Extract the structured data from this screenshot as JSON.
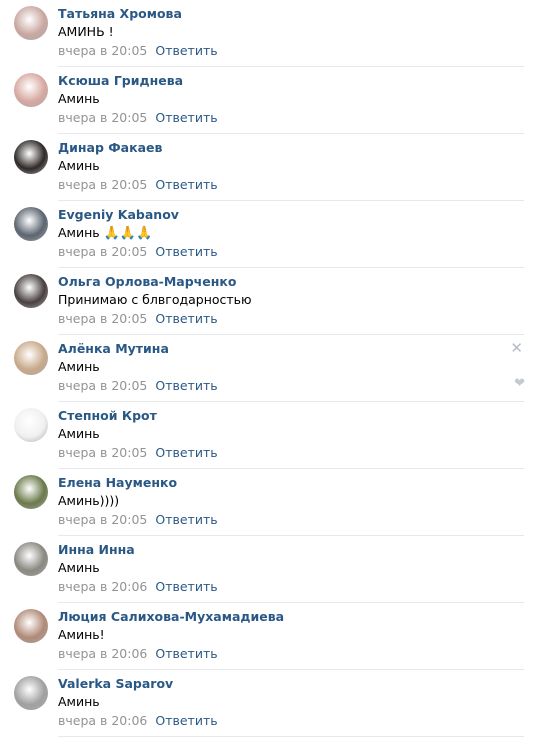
{
  "comments": [
    {
      "author": "Татьяна Хромова",
      "text": "АМИНЬ !",
      "date": "вчера в 20:05",
      "reply_label": "Ответить",
      "avatar_icon": "user-photo-icon",
      "avatar_color": "#c9a7a0"
    },
    {
      "author": "Ксюша Гриднева",
      "text": "Аминь",
      "date": "вчера в 20:05",
      "reply_label": "Ответить",
      "avatar_icon": "user-photo-icon",
      "avatar_color": "#d7a8a1"
    },
    {
      "author": "Динар Факаев",
      "text": "Аминь",
      "date": "вчера в 20:05",
      "reply_label": "Ответить",
      "avatar_icon": "user-photo-icon",
      "avatar_color": "#2f2a28"
    },
    {
      "author": "Evgeniy Kabanov",
      "text": "Аминь",
      "emoji": "🙏🙏🙏",
      "date": "вчера в 20:05",
      "reply_label": "Ответить",
      "avatar_icon": "user-photo-icon",
      "avatar_color": "#5b6570"
    },
    {
      "author": "Ольга Орлова-Марченко",
      "text": "Принимаю с блвгодарностью",
      "date": "вчера в 20:05",
      "reply_label": "Ответить",
      "avatar_icon": "user-photo-icon",
      "avatar_color": "#4a4040"
    },
    {
      "author": "Алёнка Мутина",
      "text": "Аминь",
      "date": "вчера в 20:05",
      "reply_label": "Ответить",
      "avatar_icon": "user-photo-icon",
      "avatar_color": "#c8a98a",
      "hover": true
    },
    {
      "author": "Степной Крот",
      "text": "Аминь",
      "date": "вчера в 20:05",
      "reply_label": "Ответить",
      "avatar_icon": "user-photo-icon",
      "avatar_color": "#f0f0f0"
    },
    {
      "author": "Елена Науменко",
      "text": "Аминь))))",
      "date": "вчера в 20:05",
      "reply_label": "Ответить",
      "avatar_icon": "user-photo-icon",
      "avatar_color": "#6a7a4a"
    },
    {
      "author": "Инна Инна",
      "text": "Аминь",
      "date": "вчера в 20:06",
      "reply_label": "Ответить",
      "avatar_icon": "user-photo-icon",
      "avatar_color": "#8a8880"
    },
    {
      "author": "Люция Салихова-Мухамадиева",
      "text": "Аминь!",
      "date": "вчера в 20:06",
      "reply_label": "Ответить",
      "avatar_icon": "user-photo-icon",
      "avatar_color": "#b08a78"
    },
    {
      "author": "Valerka Saparov",
      "text": "Аминь",
      "date": "вчера в 20:06",
      "reply_label": "Ответить",
      "avatar_icon": "user-photo-icon",
      "avatar_color": "#a0a0a0"
    }
  ],
  "actions": {
    "delete_icon": "close-icon",
    "delete_glyph": "✕",
    "like_icon": "heart-icon",
    "like_glyph": "❤"
  }
}
